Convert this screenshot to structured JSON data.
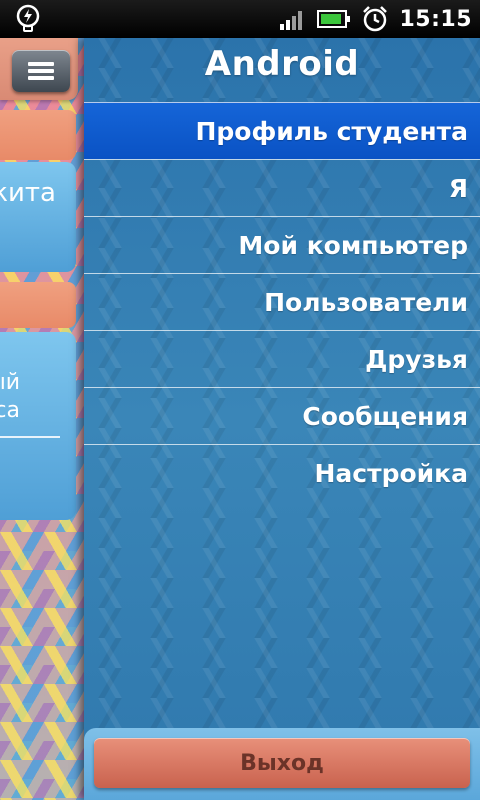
{
  "status_bar": {
    "time": "15:15",
    "icons": [
      "bulb-notification-icon",
      "signal-icon",
      "battery-icon",
      "alarm-icon"
    ]
  },
  "drawer": {
    "title": "Android",
    "items": [
      {
        "label": "Профиль студента",
        "active": true
      },
      {
        "label": "Я",
        "active": false
      },
      {
        "label": "Мой компьютер",
        "active": false
      },
      {
        "label": "Пользователи",
        "active": false
      },
      {
        "label": "Друзья",
        "active": false
      },
      {
        "label": "Сообщения",
        "active": false
      },
      {
        "label": "Настройка",
        "active": false
      }
    ],
    "exit_label": "Выход"
  },
  "background_page": {
    "card1_text": "кита",
    "card2_line1": "ый",
    "card2_line2": "са"
  },
  "colors": {
    "drawer_blue": "#2f78ad",
    "active_item": "#0a52c4",
    "exit_button": "#c9624e"
  }
}
